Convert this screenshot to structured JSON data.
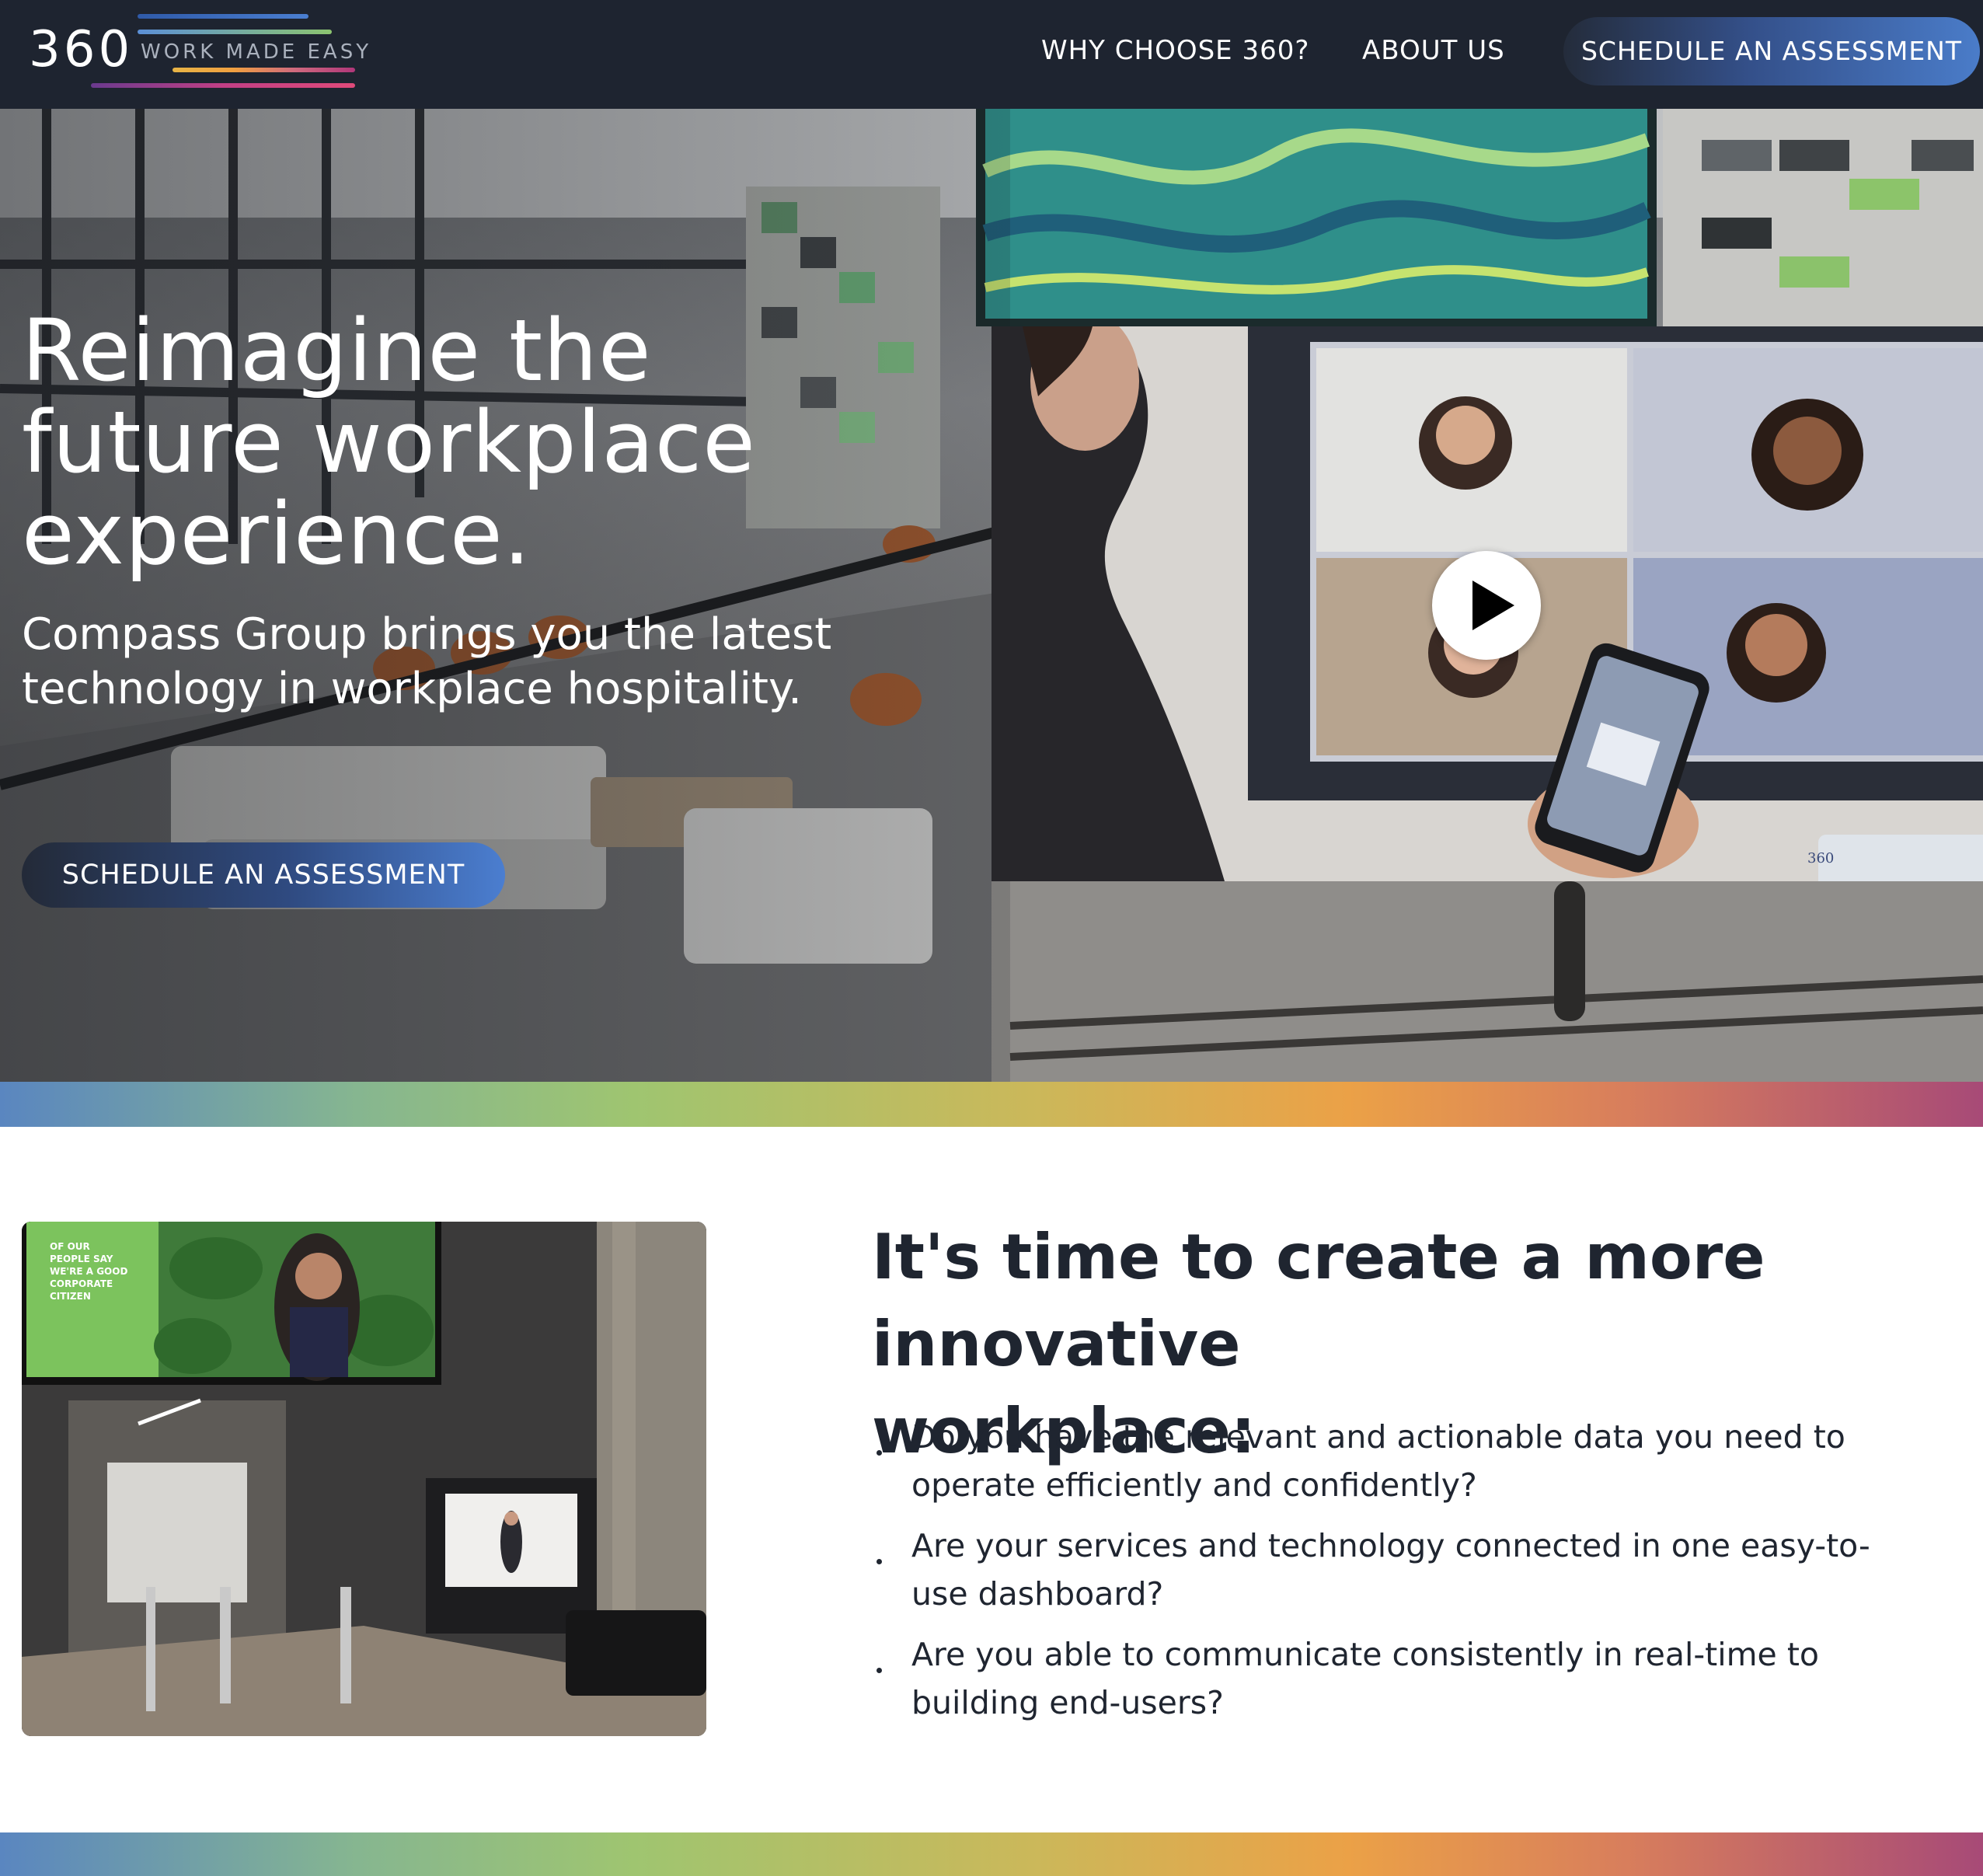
{
  "nav": {
    "logo_number": "360",
    "logo_tagline": "WORK MADE EASY",
    "links": [
      "WHY CHOOSE 360?",
      "ABOUT US"
    ],
    "cta_label": "SCHEDULE AN ASSESSMENT"
  },
  "hero": {
    "title_lines": [
      "Reimagine the",
      "future workplace",
      "experience."
    ],
    "subtitle_lines": [
      "Compass Group brings you the latest",
      "technology in workplace hospitality."
    ],
    "cta_label": "SCHEDULE AN ASSESSMENT",
    "video": {
      "play_icon": "play-icon",
      "screen_label": "360"
    }
  },
  "lobby_image": {
    "screen_text": [
      "OF OUR",
      "PEOPLE SAY",
      "WE'RE A GOOD",
      "CORPORATE",
      "CITIZEN"
    ]
  },
  "innovation": {
    "title_lines": [
      "It's time to create a more innovative",
      "workplace:"
    ],
    "questions": [
      [
        "Do you have the relevant and actionable data you need to",
        "operate efficiently and confidently?"
      ],
      [
        "Are your services and technology connected in one easy-to-",
        "use dashboard?"
      ],
      [
        "Are you able to communicate consistently in real-time to",
        "building end-users?"
      ]
    ]
  },
  "colors": {
    "nav_bg": "#1e2430",
    "text_dark": "#1f2530",
    "cta_gradient_end": "#4a7cc9",
    "stripe": [
      "#5a86c0",
      "#9fc570",
      "#eba147",
      "#a74a77"
    ]
  }
}
